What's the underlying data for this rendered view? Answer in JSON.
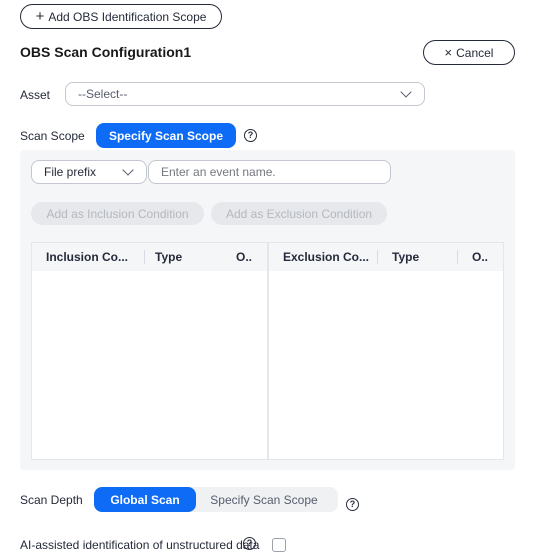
{
  "add_scope_button": {
    "plus": "+",
    "label": "Add OBS Identification Scope"
  },
  "config": {
    "title": "OBS Scan Configuration1",
    "cancel": {
      "icon": "×",
      "label": "Cancel"
    }
  },
  "asset": {
    "label": "Asset",
    "placeholder": "--Select--"
  },
  "scan_scope": {
    "label": "Scan Scope",
    "button": "Specify Scan Scope",
    "help": "?",
    "prefix_select": "File prefix",
    "event_input_placeholder": "Enter an event name.",
    "add_inclusion": "Add as Inclusion Condition",
    "add_exclusion": "Add as Exclusion Condition",
    "inclusion_table": {
      "columns": [
        "Inclusion Co...",
        "Type",
        "O.."
      ]
    },
    "exclusion_table": {
      "columns": [
        "Exclusion Co...",
        "Type",
        "O.."
      ]
    }
  },
  "scan_depth": {
    "label": "Scan Depth",
    "options": [
      "Global Scan",
      "Specify Scan Scope"
    ],
    "selected": "Global Scan",
    "help": "?"
  },
  "ai_assist": {
    "label": "AI-assisted identification of unstructured data",
    "help": "?",
    "checked": false
  },
  "icons": {
    "plus": "plus-icon",
    "close": "close-icon",
    "chevron": "chevron-down-icon",
    "help": "help-icon"
  }
}
